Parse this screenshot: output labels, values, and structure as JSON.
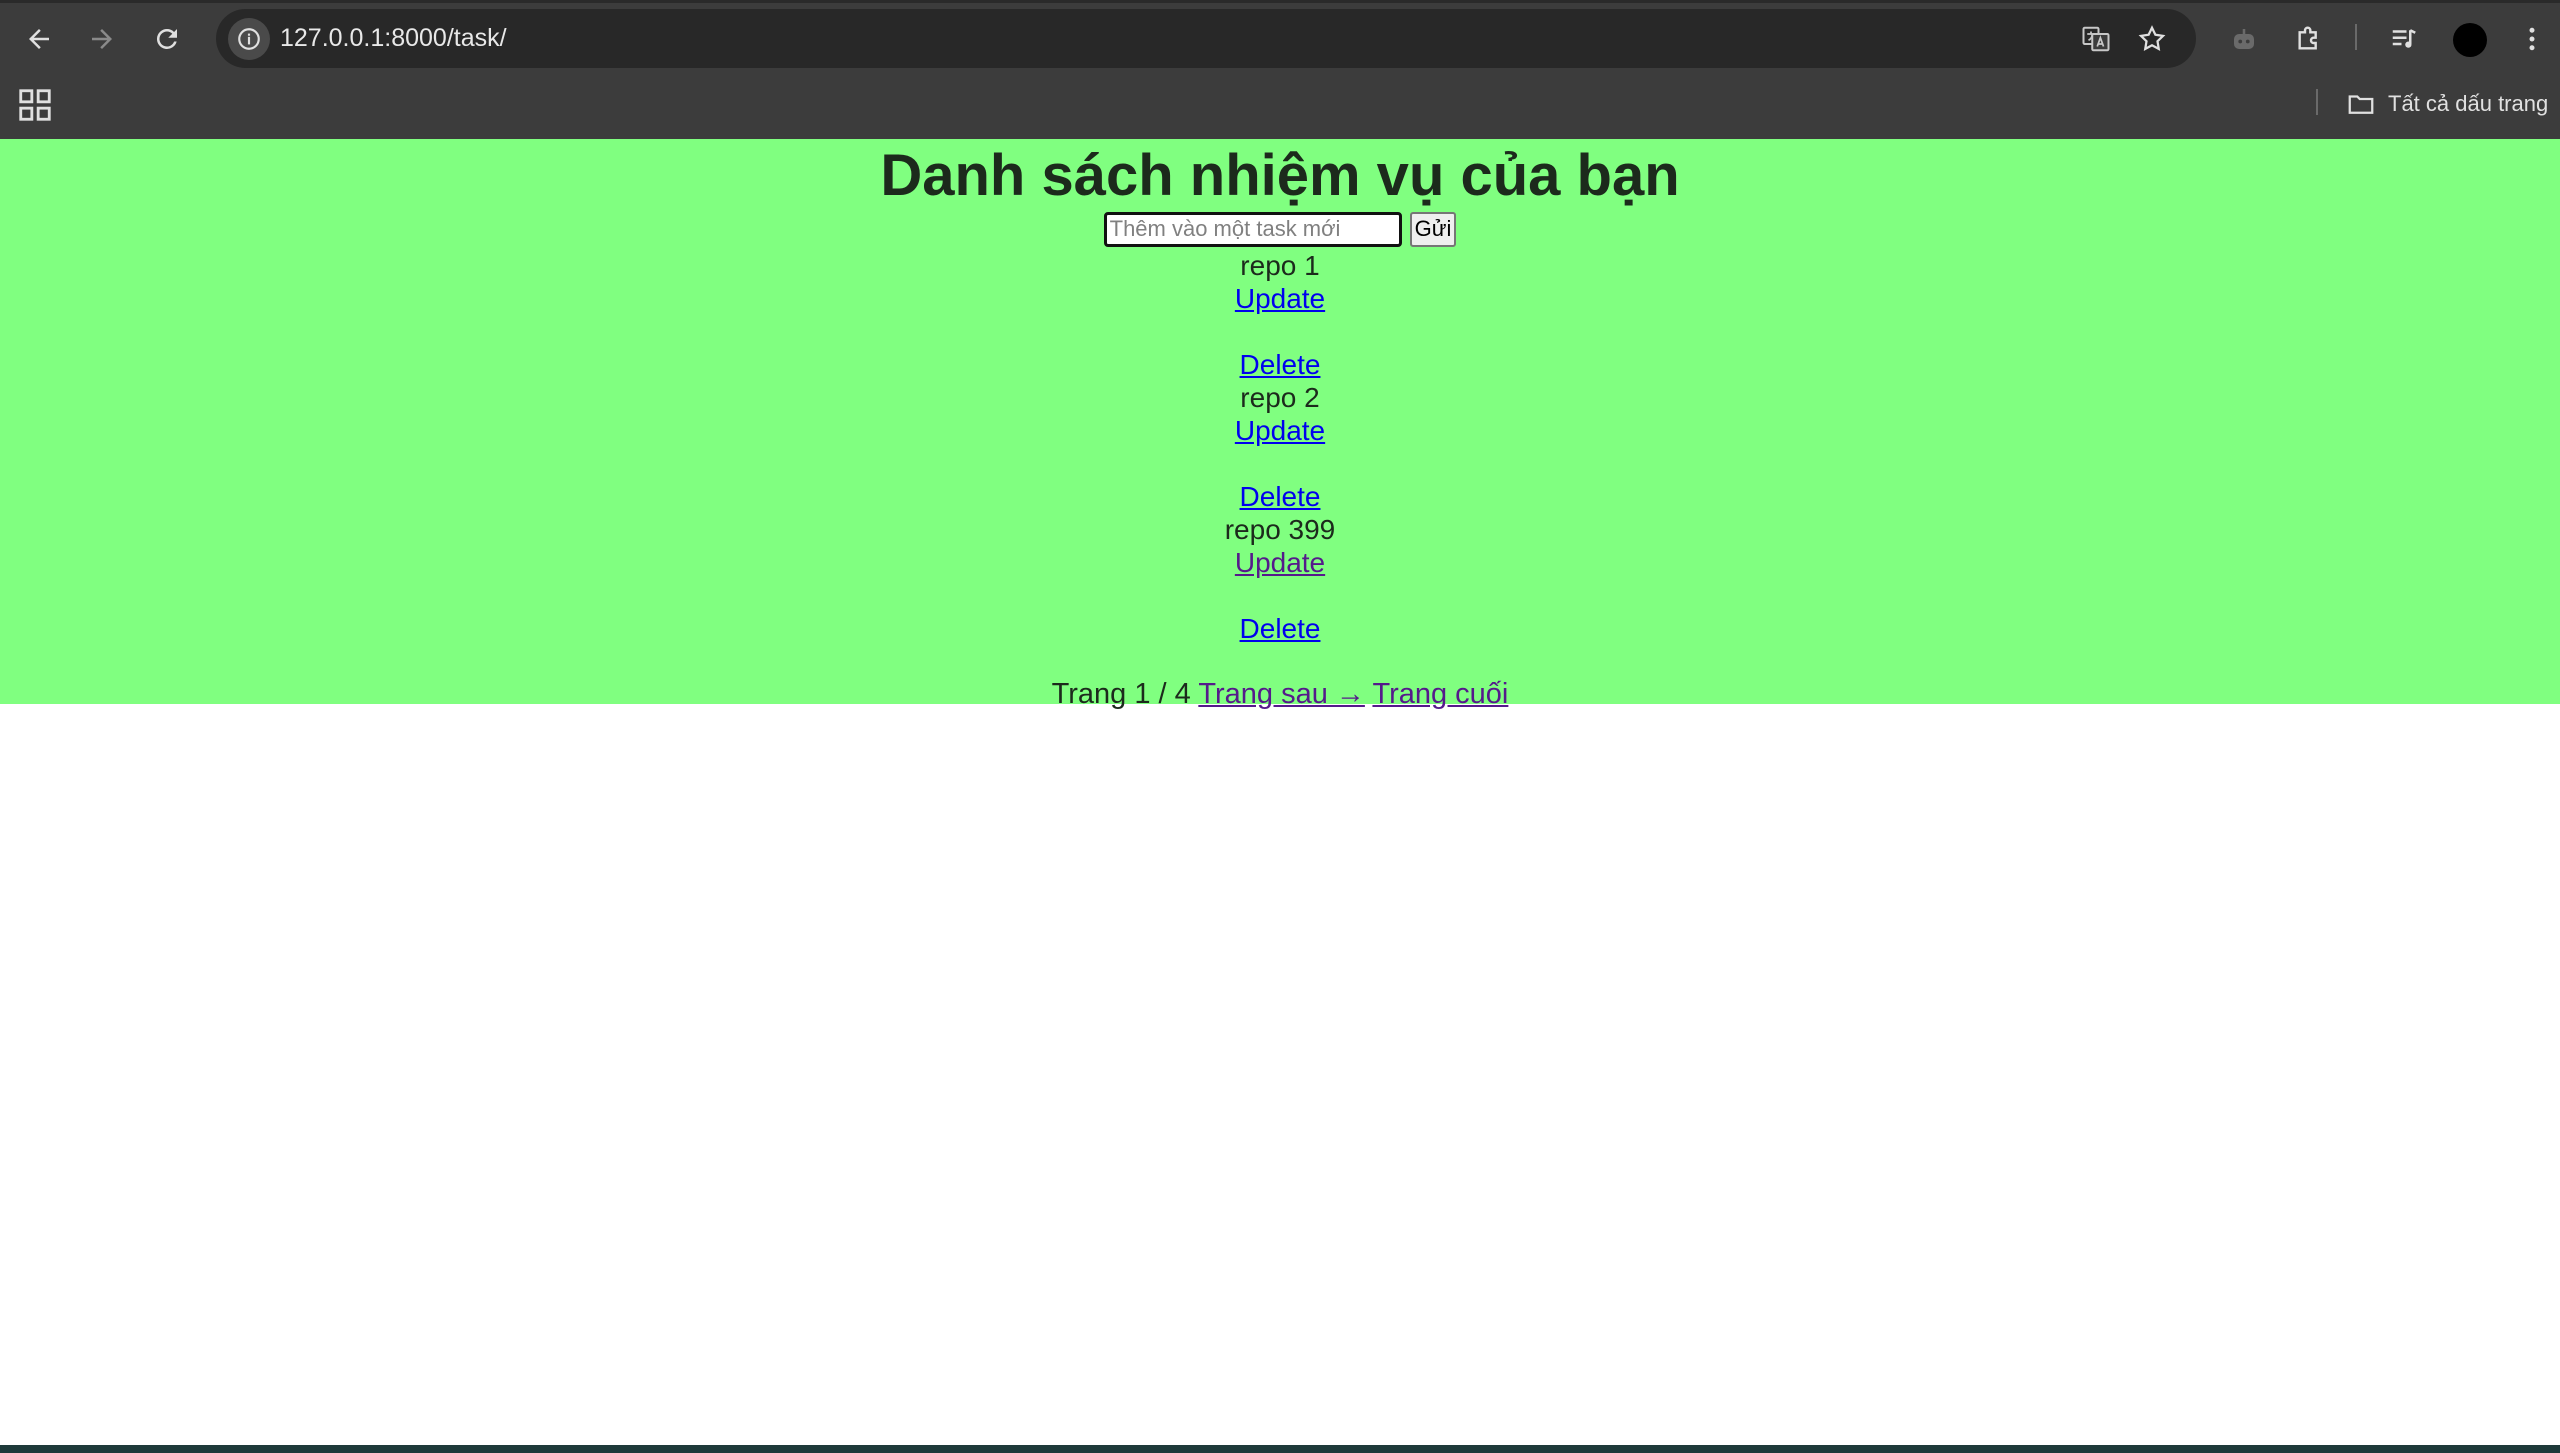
{
  "browser": {
    "url": "127.0.0.1:8000/task/",
    "bookmarks_folder_label": "Tất cả dấu trang"
  },
  "page": {
    "title": "Danh sách nhiệm vụ của bạn",
    "input_placeholder": "Thêm vào một task mới",
    "input_value": "",
    "submit_label": "Gửi",
    "tasks": [
      {
        "name": "repo 1",
        "update_label": "Update",
        "delete_label": "Delete"
      },
      {
        "name": "repo 2",
        "update_label": "Update",
        "delete_label": "Delete"
      },
      {
        "name": "repo 399",
        "update_label": "Update",
        "delete_label": "Delete"
      }
    ],
    "pagination": {
      "status": "Trang 1 / 4",
      "next_label": "Trang sau →",
      "last_label": "Trang cuối"
    }
  },
  "colors": {
    "page_background": "#80ff80",
    "link": "#0000ee",
    "visited_link": "#551a8b"
  }
}
